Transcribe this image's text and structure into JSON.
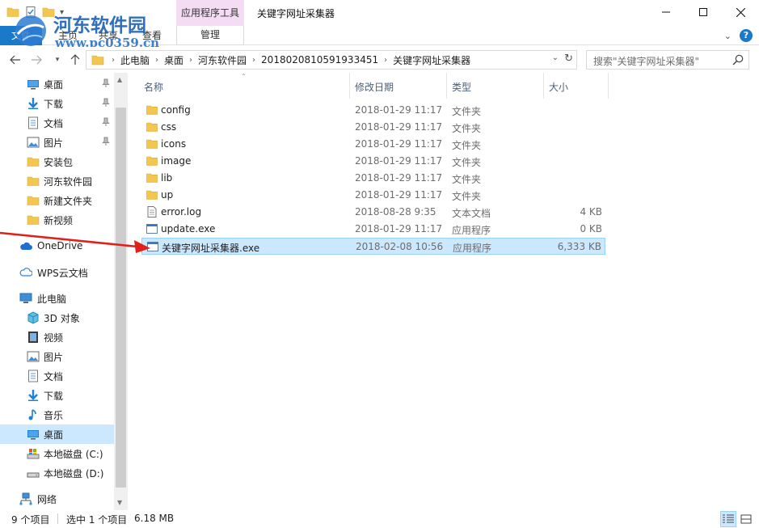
{
  "window": {
    "title": "关键字网址采集器",
    "context_tab_group": "应用程序工具"
  },
  "watermark": {
    "title": "河东软件园",
    "url": "www.pc0359.cn"
  },
  "ribbon": {
    "tabs": [
      "文件",
      "主页",
      "共享",
      "查看"
    ],
    "context_tab": "管理"
  },
  "address": {
    "crumbs": [
      "此电脑",
      "桌面",
      "河东软件园",
      "2018020810591933451",
      "关键字网址采集器"
    ]
  },
  "search": {
    "placeholder": "搜索\"关键字网址采集器\""
  },
  "nav": {
    "quick_access": [
      {
        "label": "桌面",
        "icon": "desktop-icon",
        "pinned": true
      },
      {
        "label": "下载",
        "icon": "download-icon",
        "pinned": true
      },
      {
        "label": "文档",
        "icon": "document-icon",
        "pinned": true
      },
      {
        "label": "图片",
        "icon": "picture-icon",
        "pinned": true
      },
      {
        "label": "安装包",
        "icon": "folder-icon",
        "pinned": false
      },
      {
        "label": "河东软件园",
        "icon": "folder-icon",
        "pinned": false
      },
      {
        "label": "新建文件夹",
        "icon": "folder-icon",
        "pinned": false
      },
      {
        "label": "新视频",
        "icon": "folder-icon",
        "pinned": false
      }
    ],
    "onedrive": "OneDrive",
    "wps": "WPS云文档",
    "this_pc": "此电脑",
    "pc_items": [
      {
        "label": "3D 对象",
        "icon": "3d-objects-icon"
      },
      {
        "label": "视频",
        "icon": "video-icon"
      },
      {
        "label": "图片",
        "icon": "picture-icon"
      },
      {
        "label": "文档",
        "icon": "document-icon"
      },
      {
        "label": "下载",
        "icon": "download-icon"
      },
      {
        "label": "音乐",
        "icon": "music-icon"
      },
      {
        "label": "桌面",
        "icon": "desktop-icon",
        "selected": true
      },
      {
        "label": "本地磁盘 (C:)",
        "icon": "system-drive-icon"
      },
      {
        "label": "本地磁盘 (D:)",
        "icon": "drive-icon"
      }
    ],
    "network": "网络"
  },
  "columns": {
    "name": "名称",
    "date": "修改日期",
    "type": "类型",
    "size": "大小"
  },
  "files": [
    {
      "name": "config",
      "date": "2018-01-29 11:17",
      "type": "文件夹",
      "size": "",
      "icon": "folder-icon"
    },
    {
      "name": "css",
      "date": "2018-01-29 11:17",
      "type": "文件夹",
      "size": "",
      "icon": "folder-icon"
    },
    {
      "name": "icons",
      "date": "2018-01-29 11:17",
      "type": "文件夹",
      "size": "",
      "icon": "folder-icon"
    },
    {
      "name": "image",
      "date": "2018-01-29 11:17",
      "type": "文件夹",
      "size": "",
      "icon": "folder-icon"
    },
    {
      "name": "lib",
      "date": "2018-01-29 11:17",
      "type": "文件夹",
      "size": "",
      "icon": "folder-icon"
    },
    {
      "name": "up",
      "date": "2018-01-29 11:17",
      "type": "文件夹",
      "size": "",
      "icon": "folder-icon"
    },
    {
      "name": "error.log",
      "date": "2018-08-28 9:35",
      "type": "文本文档",
      "size": "4 KB",
      "icon": "text-file-icon"
    },
    {
      "name": "update.exe",
      "date": "2018-01-29 11:17",
      "type": "应用程序",
      "size": "0 KB",
      "icon": "exe-file-icon"
    },
    {
      "name": "关键字网址采集器.exe",
      "date": "2018-02-08 10:56",
      "type": "应用程序",
      "size": "6,333 KB",
      "icon": "exe-file-icon",
      "selected": true
    }
  ],
  "status": {
    "item_count": "9 个项目",
    "selected": "选中 1 个项目",
    "selected_size": "6.18 MB"
  },
  "colors": {
    "selection": "#cce8ff",
    "selection_border": "#99d1ff",
    "context_tab": "#f4dcf5",
    "file_tab": "#1979ca",
    "arrow": "#e0201a"
  }
}
